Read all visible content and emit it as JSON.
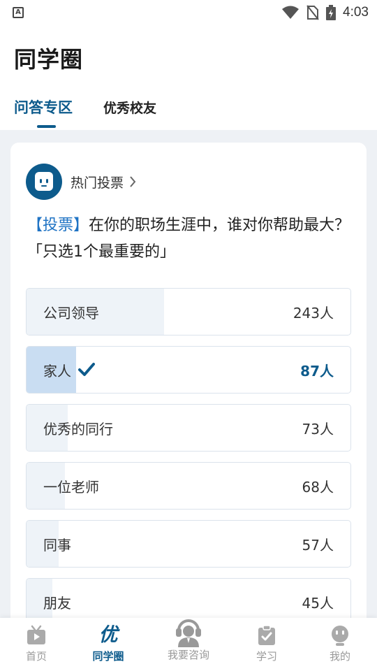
{
  "status_bar": {
    "time": "4:03",
    "app_icon_letter": "A"
  },
  "header": {
    "title": "同学圈",
    "tabs": [
      {
        "label": "问答专区",
        "active": true
      },
      {
        "label": "优秀校友",
        "active": false
      }
    ]
  },
  "poll": {
    "section_label": "热门投票",
    "question_tag": "【投票】",
    "question_text": "在你的职场生涯中，谁对你帮助最大？「只选1个最重要的」",
    "options": [
      {
        "label": "公司领导",
        "count": "243人",
        "votes": 243,
        "selected": false
      },
      {
        "label": "家人",
        "count": "87人",
        "votes": 87,
        "selected": true
      },
      {
        "label": "优秀的同行",
        "count": "73人",
        "votes": 73,
        "selected": false
      },
      {
        "label": "一位老师",
        "count": "68人",
        "votes": 68,
        "selected": false
      },
      {
        "label": "同事",
        "count": "57人",
        "votes": 57,
        "selected": false
      },
      {
        "label": "朋友",
        "count": "45人",
        "votes": 45,
        "selected": false
      }
    ]
  },
  "bottom_nav": {
    "items": [
      {
        "label": "首页",
        "icon": "tv-icon",
        "active": false
      },
      {
        "label": "同学圈",
        "icon": "you-logo-icon",
        "glyph": "优",
        "active": true
      },
      {
        "label": "我要咨询",
        "icon": "headset-agent-icon",
        "active": false
      },
      {
        "label": "学习",
        "icon": "clipboard-check-icon",
        "active": false
      },
      {
        "label": "我的",
        "icon": "robot-profile-icon",
        "active": false
      }
    ]
  },
  "colors": {
    "brand": "#0d5b8c",
    "question_tag": "#1f73c4",
    "selected_fill": "#c9ddf2",
    "unselected_fill": "#eef3f8",
    "page_background": "#eef1f5"
  }
}
